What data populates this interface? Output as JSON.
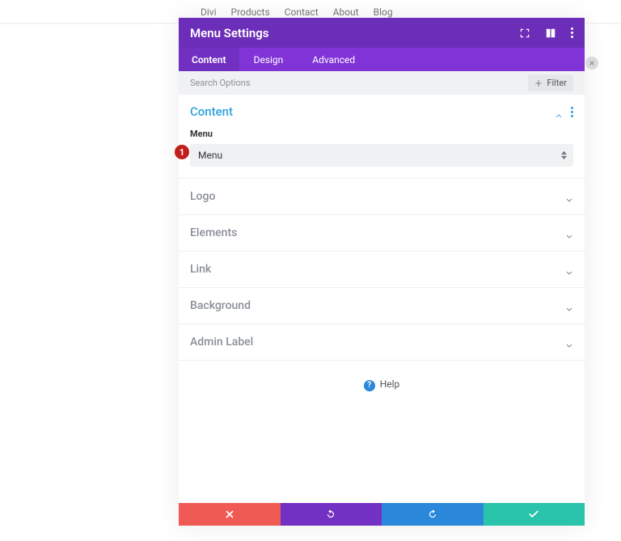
{
  "nav": {
    "items": [
      "Divi",
      "Products",
      "Contact",
      "About",
      "Blog"
    ]
  },
  "panel": {
    "title": "Menu Settings"
  },
  "tabs": {
    "items": [
      "Content",
      "Design",
      "Advanced"
    ],
    "active": 0
  },
  "search": {
    "placeholder": "Search Options",
    "filter_label": "Filter"
  },
  "sections": {
    "content": {
      "title": "Content",
      "field_label": "Menu",
      "select_value": "Menu"
    },
    "collapsed": [
      {
        "title": "Logo"
      },
      {
        "title": "Elements"
      },
      {
        "title": "Link"
      },
      {
        "title": "Background"
      },
      {
        "title": "Admin Label"
      }
    ]
  },
  "help": {
    "label": "Help"
  },
  "annotation": {
    "number": "1"
  },
  "icons": {
    "expand_full": "expand-full-icon",
    "columns": "columns-icon",
    "more": "more-icon",
    "plus": "plus-icon",
    "chevron_up": "chevron-up-icon",
    "chevron_down": "chevron-down-icon",
    "close": "close-icon",
    "undo": "undo-icon",
    "redo": "redo-icon",
    "check": "check-icon"
  }
}
